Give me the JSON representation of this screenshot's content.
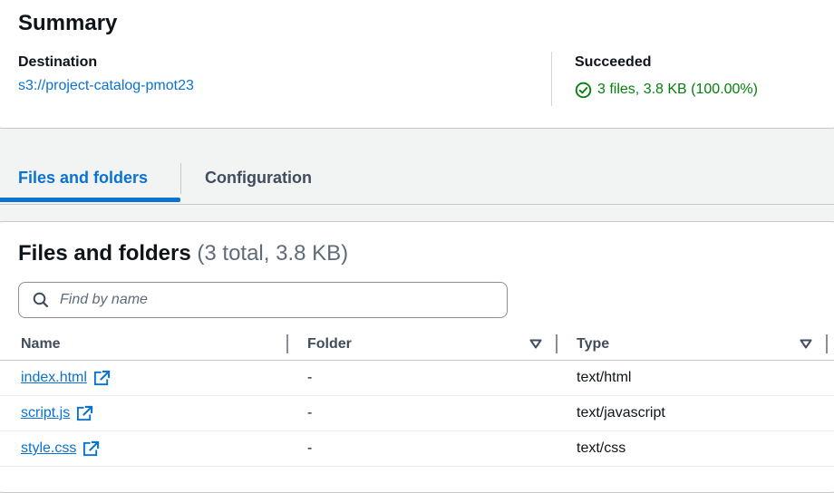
{
  "summary": {
    "title": "Summary",
    "destination_label": "Destination",
    "destination_value": "s3://project-catalog-pmot23",
    "status_label": "Succeeded",
    "status_value": "3 files, 3.8 KB (100.00%)"
  },
  "tabs": [
    {
      "label": "Files and folders",
      "active": true
    },
    {
      "label": "Configuration",
      "active": false
    }
  ],
  "files": {
    "title": "Files and folders",
    "count": "(3 total, 3.8 KB)",
    "search_placeholder": "Find by name",
    "columns": [
      "Name",
      "Folder",
      "Type"
    ],
    "rows": [
      {
        "name": "index.html",
        "folder": "-",
        "type": "text/html"
      },
      {
        "name": "script.js",
        "folder": "-",
        "type": "text/javascript"
      },
      {
        "name": "style.css",
        "folder": "-",
        "type": "text/css"
      }
    ]
  },
  "icons": {
    "status": "check-circle-icon",
    "search": "search-icon",
    "external": "external-link-icon",
    "sort": "caret-down-icon"
  },
  "colors": {
    "link": "#0972d3",
    "success": "#037f0c",
    "text": "#0f141a",
    "muted": "#5f6b7a"
  }
}
